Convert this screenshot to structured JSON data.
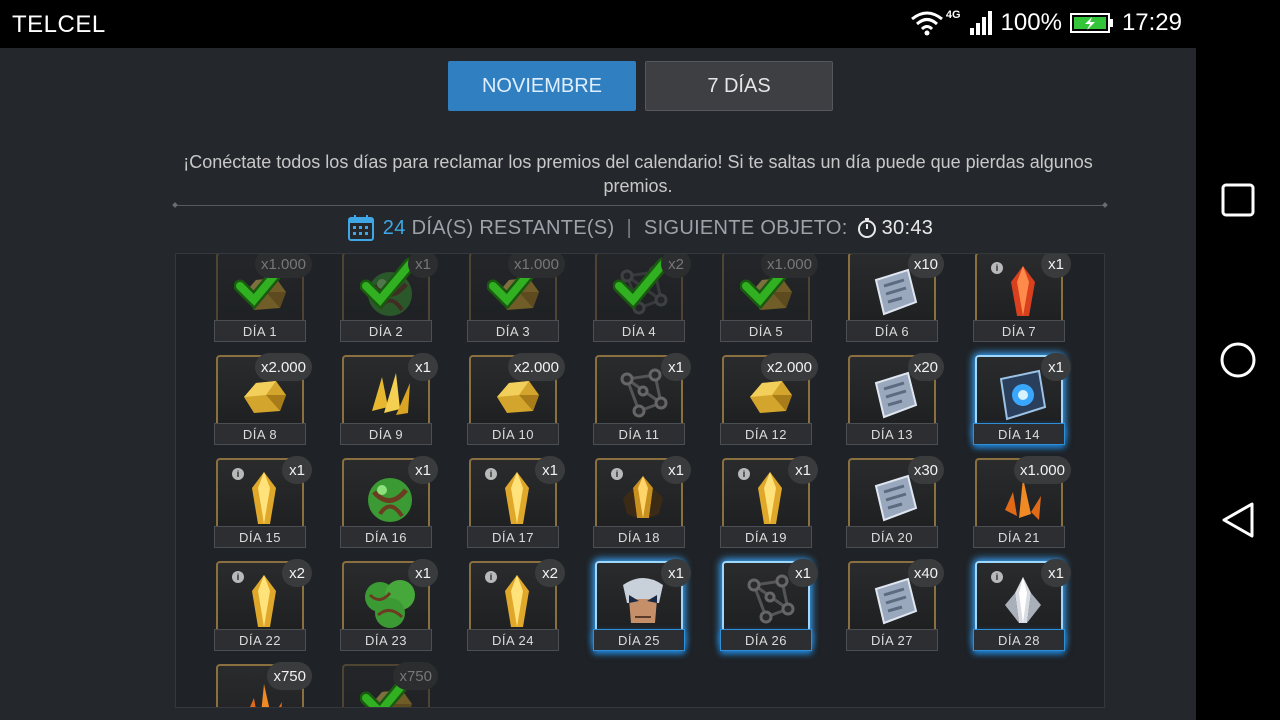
{
  "status_bar": {
    "carrier": "TELCEL",
    "network": "4G",
    "battery": "100%",
    "time": "17:29"
  },
  "tabs": [
    {
      "label": "NOVIEMBRE",
      "active": true
    },
    {
      "label": "7 DÍAS",
      "active": false
    }
  ],
  "intro_text": "¡Conéctate todos los días para reclamar los premios del calendario! Si te saltas un día puede que pierdas algunos premios.",
  "remaining": {
    "days": "24",
    "days_label": "DÍA(S) RESTANTE(S)",
    "next_label": "SIGUIENTE OBJETO:",
    "timer": "30:43"
  },
  "days": [
    {
      "label": "DÍA 1",
      "qty": "x1.000",
      "icon": "gold-icon",
      "claimed": true
    },
    {
      "label": "DÍA 2",
      "qty": "x1",
      "icon": "crystal-orb-icon",
      "claimed": true
    },
    {
      "label": "DÍA 3",
      "qty": "x1.000",
      "icon": "gold-icon",
      "claimed": true
    },
    {
      "label": "DÍA 4",
      "qty": "x2",
      "icon": "molecule-icon",
      "claimed": true
    },
    {
      "label": "DÍA 5",
      "qty": "x1.000",
      "icon": "gold-icon",
      "claimed": true
    },
    {
      "label": "DÍA 6",
      "qty": "x10",
      "icon": "iso-tablet-icon",
      "claimed": false
    },
    {
      "label": "DÍA 7",
      "qty": "x1",
      "icon": "red-crystal-icon",
      "claimed": false,
      "info": true
    },
    {
      "label": "DÍA 8",
      "qty": "x2.000",
      "icon": "gold-icon",
      "claimed": false
    },
    {
      "label": "DÍA 9",
      "qty": "x1",
      "icon": "gold-shards-icon",
      "claimed": false
    },
    {
      "label": "DÍA 10",
      "qty": "x2.000",
      "icon": "gold-icon",
      "claimed": false
    },
    {
      "label": "DÍA 11",
      "qty": "x1",
      "icon": "molecule-icon",
      "claimed": false
    },
    {
      "label": "DÍA 12",
      "qty": "x2.000",
      "icon": "gold-icon",
      "claimed": false
    },
    {
      "label": "DÍA 13",
      "qty": "x20",
      "icon": "iso-tablet-icon",
      "claimed": false
    },
    {
      "label": "DÍA 14",
      "qty": "x1",
      "icon": "blue-tablet-icon",
      "claimed": false,
      "highlight": true
    },
    {
      "label": "DÍA 15",
      "qty": "x1",
      "icon": "yellow-crystal-icon",
      "claimed": false,
      "info": true
    },
    {
      "label": "DÍA 16",
      "qty": "x1",
      "icon": "crystal-orb-icon",
      "claimed": false
    },
    {
      "label": "DÍA 17",
      "qty": "x1",
      "icon": "yellow-crystal-icon",
      "claimed": false,
      "info": true
    },
    {
      "label": "DÍA 18",
      "qty": "x1",
      "icon": "dark-crystal-icon",
      "claimed": false,
      "info": true
    },
    {
      "label": "DÍA 19",
      "qty": "x1",
      "icon": "yellow-crystal-icon",
      "claimed": false,
      "info": true
    },
    {
      "label": "DÍA 20",
      "qty": "x30",
      "icon": "iso-tablet-icon",
      "claimed": false
    },
    {
      "label": "DÍA 21",
      "qty": "x1.000",
      "icon": "orange-shards-icon",
      "claimed": false
    },
    {
      "label": "DÍA 22",
      "qty": "x2",
      "icon": "yellow-crystal-icon",
      "claimed": false,
      "info": true
    },
    {
      "label": "DÍA 23",
      "qty": "x1",
      "icon": "crystal-orbs-icon",
      "claimed": false
    },
    {
      "label": "DÍA 24",
      "qty": "x2",
      "icon": "yellow-crystal-icon",
      "claimed": false,
      "info": true
    },
    {
      "label": "DÍA 25",
      "qty": "x1",
      "icon": "champion-icon",
      "claimed": false,
      "highlight": true
    },
    {
      "label": "DÍA 26",
      "qty": "x1",
      "icon": "molecule-icon",
      "claimed": false,
      "highlight": true
    },
    {
      "label": "DÍA 27",
      "qty": "x40",
      "icon": "iso-tablet-icon",
      "claimed": false
    },
    {
      "label": "DÍA 28",
      "qty": "x1",
      "icon": "silver-crystal-icon",
      "claimed": false,
      "info": true,
      "highlight": true
    },
    {
      "label": "",
      "qty": "x750",
      "icon": "orange-shards-icon",
      "claimed": false
    },
    {
      "label": "",
      "qty": "x750",
      "icon": "gold-icon",
      "claimed": true
    }
  ],
  "colors": {
    "panel": "#24272c",
    "tab_active": "#2f7fc1",
    "accent_blue": "#3fa7e6",
    "frame_gold": "#8a6f3f"
  }
}
